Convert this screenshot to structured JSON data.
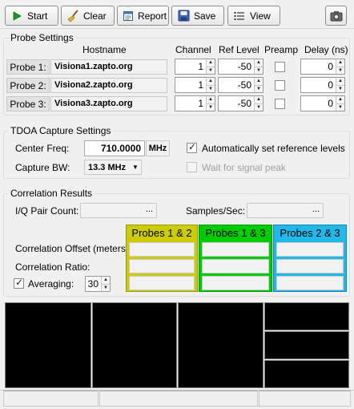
{
  "toolbar": {
    "start_label": "Start",
    "clear_label": "Clear",
    "report_label": "Report",
    "save_label": "Save",
    "view_label": "View"
  },
  "probe_settings": {
    "title": "Probe Settings",
    "headers": {
      "hostname": "Hostname",
      "channel": "Channel",
      "ref_level": "Ref Level",
      "preamp": "Preamp",
      "delay": "Delay (ns)"
    },
    "probes": [
      {
        "label": "Probe 1:",
        "hostname": "Visiona1.zapto.org",
        "channel": "1",
        "ref_level": "-50",
        "preamp": false,
        "delay": "0"
      },
      {
        "label": "Probe 2:",
        "hostname": "Visiona2.zapto.org",
        "channel": "1",
        "ref_level": "-50",
        "preamp": false,
        "delay": "0"
      },
      {
        "label": "Probe 3:",
        "hostname": "Visiona3.zapto.org",
        "channel": "1",
        "ref_level": "-50",
        "preamp": false,
        "delay": "0"
      }
    ]
  },
  "tdoa": {
    "title": "TDOA Capture Settings",
    "center_freq_label": "Center Freq:",
    "center_freq_value": "710.0000",
    "center_freq_unit": "MHz",
    "capture_bw_label": "Capture BW:",
    "capture_bw_value": "13.3 MHz",
    "auto_ref_label": "Automatically set reference levels",
    "auto_ref_checked": true,
    "wait_signal_label": "Wait for signal peak",
    "wait_signal_checked": false
  },
  "correlation": {
    "title": "Correlation Results",
    "iq_pair_label": "I/Q Pair Count:",
    "iq_pair_ellipsis": "...",
    "samples_label": "Samples/Sec:",
    "samples_ellipsis": "...",
    "offset_label": "Correlation Offset (meters):",
    "ratio_label": "Correlation Ratio:",
    "averaging_label": "Averaging:",
    "averaging_checked": true,
    "averaging_value": "30",
    "pairs": [
      {
        "label": "Probes 1 & 2",
        "color": "#cccc00"
      },
      {
        "label": "Probes 1 & 3",
        "color": "#00cc00"
      },
      {
        "label": "Probes 2 & 3",
        "color": "#20b8e8"
      }
    ]
  }
}
